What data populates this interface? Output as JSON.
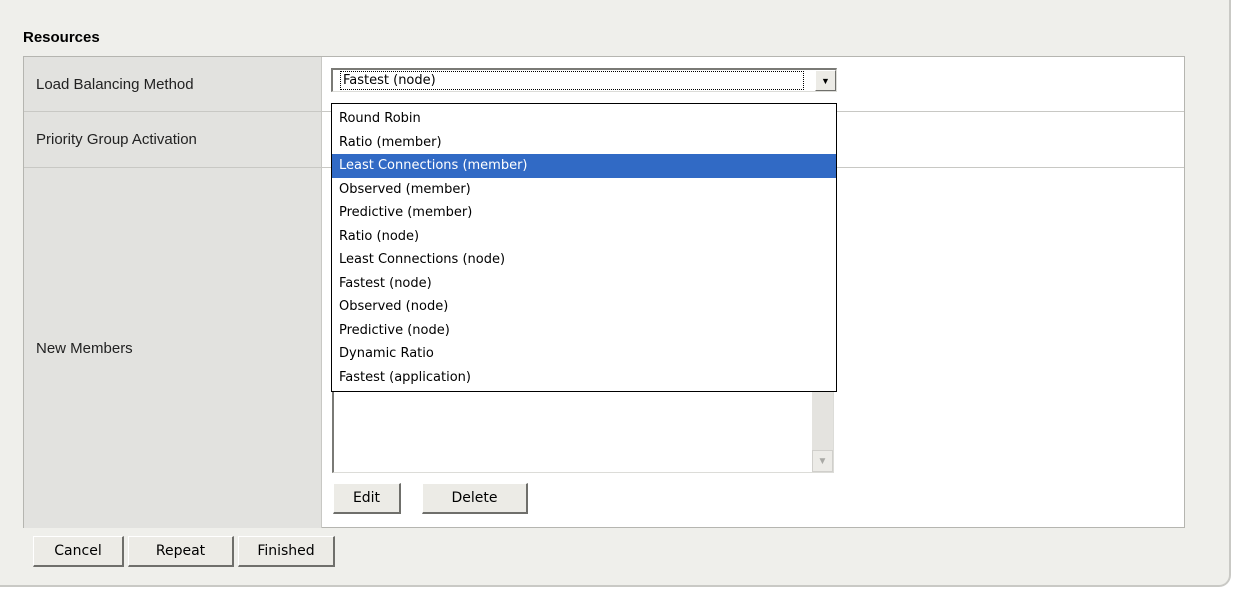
{
  "section": {
    "title": "Resources"
  },
  "rows": {
    "load_balancing_label": "Load Balancing Method",
    "priority_group_label": "Priority Group Activation",
    "new_members_label": "New Members"
  },
  "load_balancing_select": {
    "selected_value": "Fastest (node)",
    "options": [
      "Round Robin",
      "Ratio (member)",
      "Least Connections (member)",
      "Observed (member)",
      "Predictive (member)",
      "Ratio (node)",
      "Least Connections (node)",
      "Fastest (node)",
      "Observed (node)",
      "Predictive (node)",
      "Dynamic Ratio",
      "Fastest (application)"
    ],
    "highlighted_option": "Least Connections (member)",
    "highlight_color": "#316ac5"
  },
  "members_actions": {
    "edit_label": "Edit",
    "delete_label": "Delete"
  },
  "footer_actions": {
    "cancel_label": "Cancel",
    "repeat_label": "Repeat",
    "finished_label": "Finished"
  },
  "icons": {
    "dropdown_arrow": "chevron-down-icon",
    "scroll_down": "scroll-down-arrow-icon"
  }
}
